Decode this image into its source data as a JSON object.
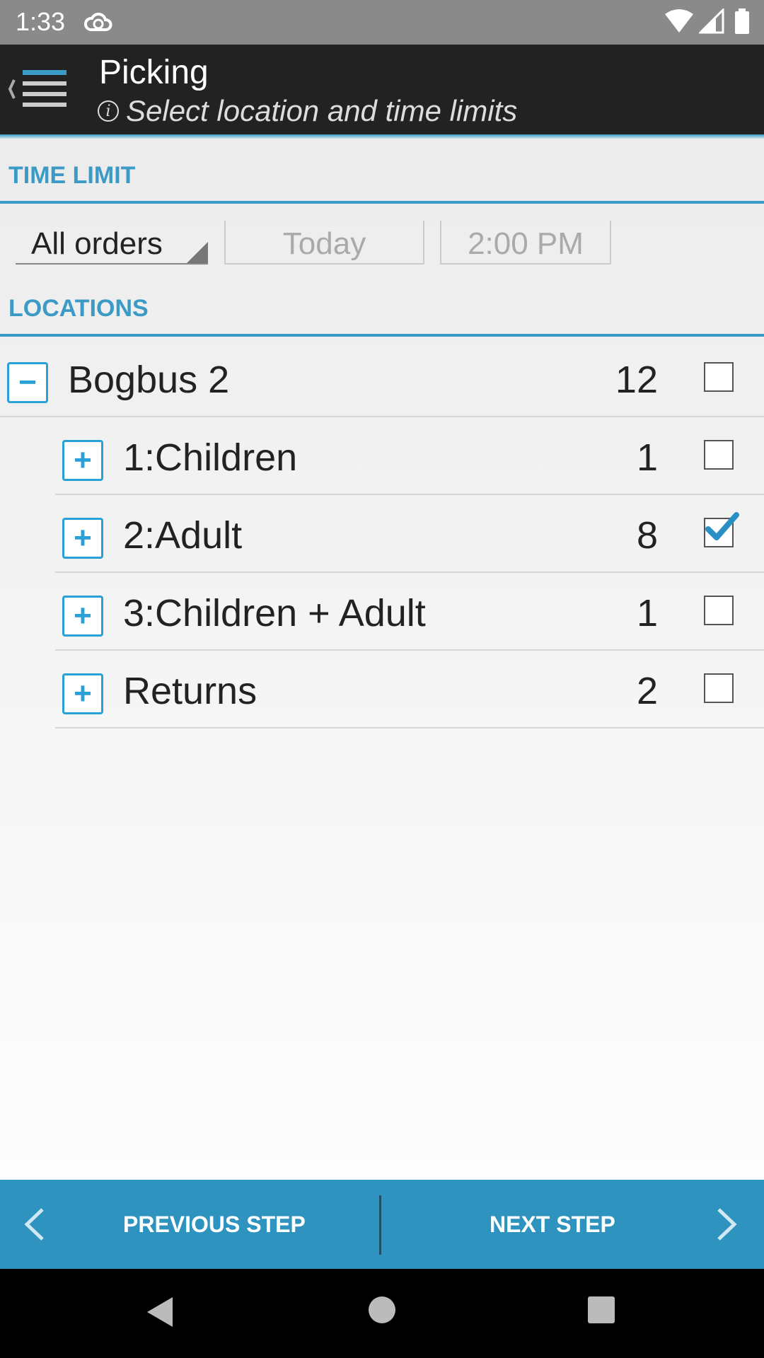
{
  "status": {
    "time": "1:33"
  },
  "header": {
    "title": "Picking",
    "subtitle": "Select location and time limits",
    "info_glyph": "i"
  },
  "time_limit": {
    "section_label": "TIME LIMIT",
    "order_filter": "All orders",
    "date": "Today",
    "time": "2:00 PM"
  },
  "locations": {
    "section_label": "LOCATIONS",
    "items": [
      {
        "label": "Bogbus 2",
        "count": "12",
        "toggle": "−",
        "checked": false
      },
      {
        "label": "1:Children",
        "count": "1",
        "toggle": "+",
        "checked": false
      },
      {
        "label": "2:Adult",
        "count": "8",
        "toggle": "+",
        "checked": true
      },
      {
        "label": "3:Children + Adult",
        "count": "1",
        "toggle": "+",
        "checked": false
      },
      {
        "label": "Returns",
        "count": "2",
        "toggle": "+",
        "checked": false
      }
    ]
  },
  "footer": {
    "previous_label": "PREVIOUS STEP",
    "next_label": "NEXT STEP"
  },
  "colors": {
    "accent": "#3b9bc6",
    "footer_bg": "#2e93bf",
    "toggle": "#29a0d6",
    "appbar": "#222222"
  },
  "icons": [
    "cloud-sync-icon",
    "wifi-icon",
    "signal-icon",
    "battery-icon",
    "menu-icon",
    "info-icon",
    "collapse-icon",
    "expand-icon",
    "checkbox-icon",
    "chevron-left-icon",
    "chevron-right-icon",
    "nav-back-icon",
    "nav-home-icon",
    "nav-recents-icon"
  ]
}
